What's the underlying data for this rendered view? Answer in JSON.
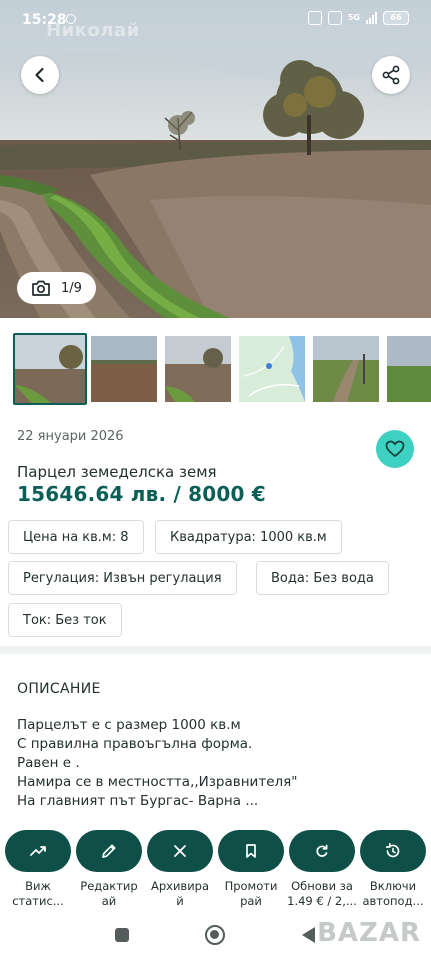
{
  "status_bar": {
    "time": "15:28",
    "user_overlay": "Николай",
    "battery": "66",
    "network": "5G"
  },
  "hero": {
    "photo_counter": "1/9",
    "back_icon": "chevron-left-icon",
    "share_icon": "share-icon",
    "camera_icon": "camera-icon"
  },
  "listing": {
    "date": "22 януари 2026",
    "title": "Парцел земеделска земя",
    "price": "15646.64 лв. / 8000 €",
    "favorite_icon": "heart-icon",
    "accent_color": "#0b5f57",
    "favorite_color": "#3ed0c0"
  },
  "chips": [
    "Цена на кв.м: 8",
    "Квадратура: 1000 кв.м",
    "Регулация: Извън регулация",
    "Вода: Без вода",
    "Ток: Без ток"
  ],
  "description": {
    "heading": "ОПИСАНИЕ",
    "lines": [
      "Парцелът е с размер 1000 кв.м",
      "С правилна правоъгълна форма.",
      "Равен е .",
      "Намира се в местността,,Изравнителя\"",
      "На главният път Бургас- Варна ..."
    ]
  },
  "actions": [
    {
      "icon": "trending-up-icon",
      "label1": "Виж",
      "label2": "статис..."
    },
    {
      "icon": "pencil-icon",
      "label1": "Редактир",
      "label2": "ай"
    },
    {
      "icon": "close-icon",
      "label1": "Архивира",
      "label2": "й"
    },
    {
      "icon": "bookmark-icon",
      "label1": "Промоти",
      "label2": "рай"
    },
    {
      "icon": "refresh-icon",
      "label1": "Обнови за",
      "label2": "1.49 € / 2,..."
    },
    {
      "icon": "auto-renew-icon",
      "label1": "Включи",
      "label2": "автопод..."
    }
  ],
  "watermark": "BAZAR",
  "action_color": "#0e4f48"
}
